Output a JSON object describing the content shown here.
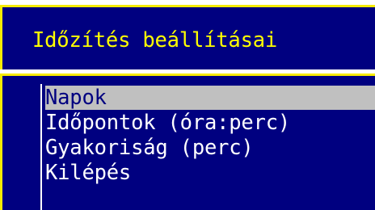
{
  "window": {
    "title": "Időzítés beállításai"
  },
  "menu": {
    "selected_index": 0,
    "items": [
      {
        "label": "Napok"
      },
      {
        "label": "Időpontok (óra:perc)"
      },
      {
        "label": "Gyakoriság (perc)"
      },
      {
        "label": "Kilépés"
      }
    ]
  },
  "colors": {
    "background": "#000080",
    "border": "#f6ec00",
    "title_text": "#ffff00",
    "menu_text": "#ffffff",
    "highlight_bg": "#c0c0c0",
    "highlight_text": "#000080"
  }
}
